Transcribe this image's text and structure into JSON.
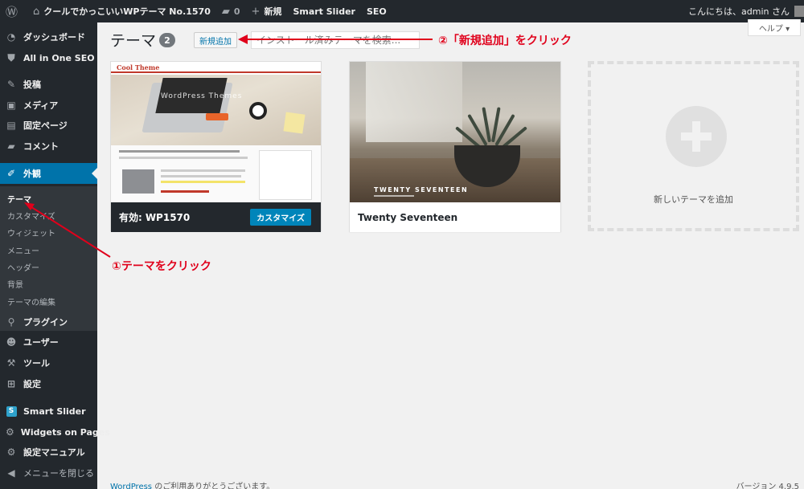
{
  "colors": {
    "accent": "#0073aa",
    "annotation": "#e0001b",
    "adminbar": "#23282d"
  },
  "adminbar": {
    "site_name": "クールでかっこいいWPテーマ No.1570",
    "comments_count": "0",
    "new_label": "新規",
    "smart_slider": "Smart Slider",
    "seo": "SEO",
    "greeting": "こんにちは、admin さん"
  },
  "sidebar": {
    "items": [
      {
        "label": "ダッシュボード",
        "icon": "dashboard-icon"
      },
      {
        "label": "All in One SEO",
        "icon": "shield-icon"
      },
      {
        "label": "投稿",
        "icon": "pin-icon"
      },
      {
        "label": "メディア",
        "icon": "media-icon"
      },
      {
        "label": "固定ページ",
        "icon": "page-icon"
      },
      {
        "label": "コメント",
        "icon": "comment-icon"
      },
      {
        "label": "外観",
        "icon": "brush-icon"
      },
      {
        "label": "プラグイン",
        "icon": "plugin-icon"
      },
      {
        "label": "ユーザー",
        "icon": "user-icon"
      },
      {
        "label": "ツール",
        "icon": "wrench-icon"
      },
      {
        "label": "設定",
        "icon": "settings-icon"
      },
      {
        "label": "Smart Slider",
        "icon": "smart-slider-icon"
      },
      {
        "label": "Widgets on Pages",
        "icon": "widgets-icon"
      },
      {
        "label": "設定マニュアル",
        "icon": "gear-icon"
      },
      {
        "label": "メニューを閉じる",
        "icon": "collapse-icon"
      }
    ],
    "submenu": [
      "テーマ",
      "カスタマイズ",
      "ウィジェット",
      "メニュー",
      "ヘッダー",
      "背景",
      "テーマの編集"
    ],
    "smart_slider_badge": "S"
  },
  "main": {
    "title": "テーマ",
    "count": "2",
    "add_new": "新規追加",
    "search_placeholder": "インストール済みテーマを検索...",
    "help": "ヘルプ ▾",
    "themes": [
      {
        "name": "WP1570",
        "active_prefix": "有効:",
        "customize": "カスタマイズ",
        "logo": "Cool Theme",
        "hero_text": "WordPress Themes"
      },
      {
        "name": "Twenty Seventeen",
        "shot_title": "TWENTY SEVENTEEN"
      }
    ],
    "add_theme_label": "新しいテーマを追加"
  },
  "annotations": {
    "step1": "①テーマをクリック",
    "step2": "②「新規追加」をクリック"
  },
  "footer": {
    "wordpress_link": "WordPress",
    "thanks": " のご利用ありがとうございます。",
    "version": "バージョン 4.9.5"
  }
}
